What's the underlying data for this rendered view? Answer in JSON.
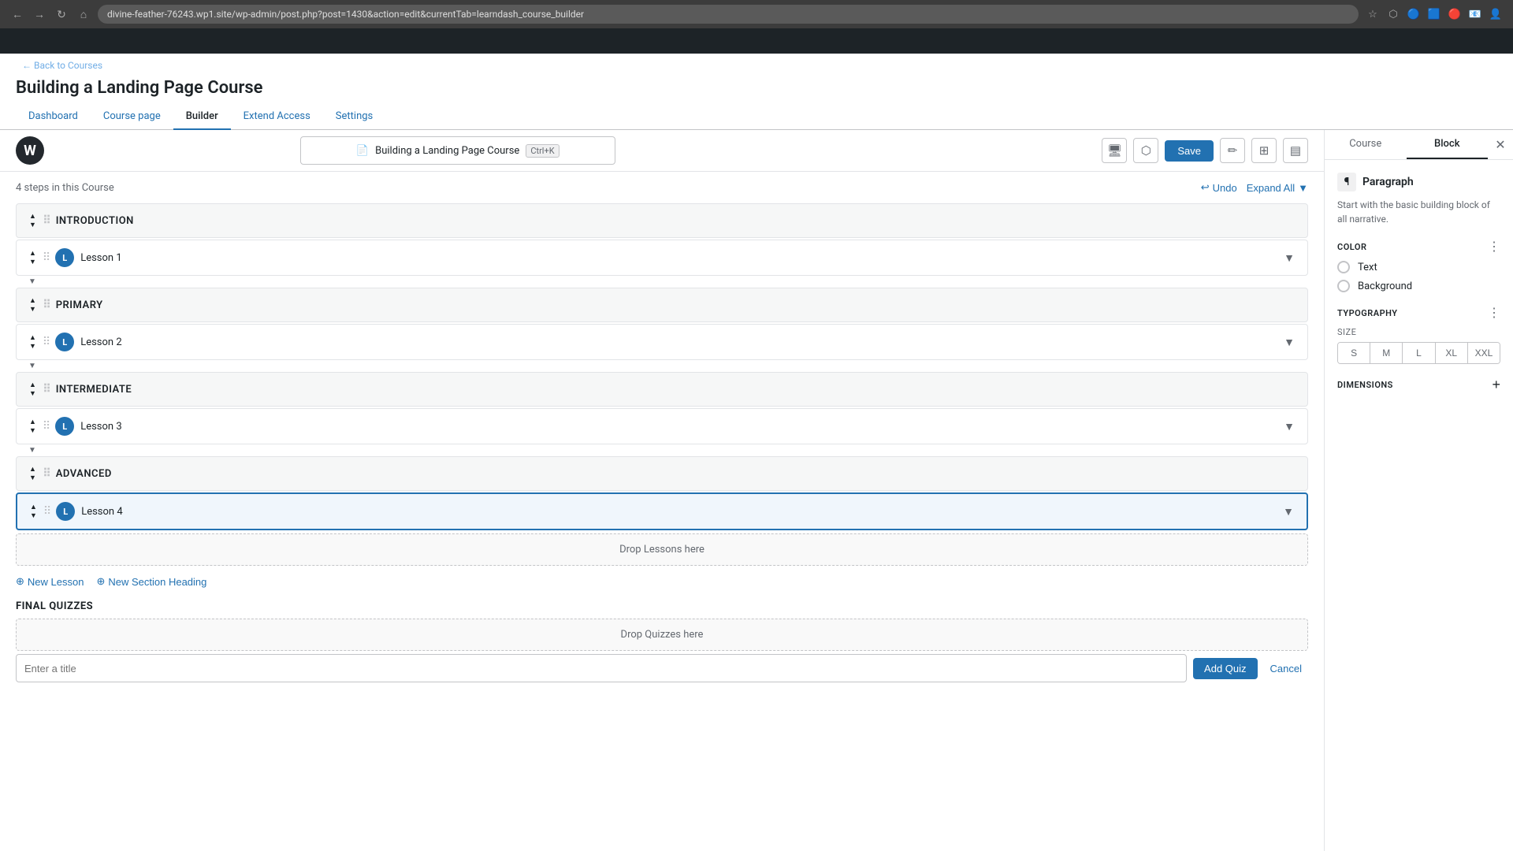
{
  "browser": {
    "url": "divine-feather-76243.wp1.site/wp-admin/post.php?post=1430&action=edit&currentTab=learndash_course_builder",
    "nav": {
      "back": "←",
      "forward": "→",
      "refresh": "↻"
    }
  },
  "admin": {
    "back_link": "← Back to Courses",
    "page_title": "Building a Landing Page Course",
    "tabs": [
      {
        "id": "dashboard",
        "label": "Dashboard",
        "active": false
      },
      {
        "id": "course-page",
        "label": "Course page",
        "active": false
      },
      {
        "id": "builder",
        "label": "Builder",
        "active": true
      },
      {
        "id": "extend-access",
        "label": "Extend Access",
        "active": false
      },
      {
        "id": "settings",
        "label": "Settings",
        "active": false
      }
    ]
  },
  "toolbar": {
    "wp_logo": "W",
    "course_title": "Building a Landing Page Course",
    "keyboard_shortcut": "Ctrl+K",
    "save_label": "Save",
    "icons": {
      "desktop": "🖥",
      "external": "⬡",
      "edit": "✏",
      "grid": "⊞",
      "layout": "▤"
    }
  },
  "builder": {
    "steps_count": "4 steps in this Course",
    "undo_label": "Undo",
    "expand_all_label": "Expand All",
    "sections": [
      {
        "id": "introduction",
        "label": "INTRODUCTION",
        "lessons": [
          {
            "id": "lesson-1",
            "label": "Lesson 1",
            "active": false
          }
        ]
      },
      {
        "id": "primary",
        "label": "PRIMARY",
        "lessons": [
          {
            "id": "lesson-2",
            "label": "Lesson 2",
            "active": false
          }
        ]
      },
      {
        "id": "intermediate",
        "label": "INTERMEDIATE",
        "lessons": [
          {
            "id": "lesson-3",
            "label": "Lesson 3",
            "active": false
          }
        ]
      },
      {
        "id": "advanced",
        "label": "ADVANCED",
        "lessons": [
          {
            "id": "lesson-4",
            "label": "Lesson 4",
            "active": true
          }
        ]
      }
    ],
    "drop_lessons_label": "Drop Lessons here",
    "drop_quizzes_label": "Drop Quizzes here",
    "add_lesson_label": "New Lesson",
    "add_section_label": "New Section Heading",
    "final_quizzes_label": "FINAL QUIZZES",
    "add_quiz_btn_label": "Add Quiz",
    "cancel_btn_label": "Cancel",
    "quiz_input_placeholder": "Enter a title"
  },
  "sidebar": {
    "course_tab": "Course",
    "block_tab": "Block",
    "close_icon": "✕",
    "block": {
      "icon": "¶",
      "name": "Paragraph",
      "description": "Start with the basic building block of all narrative."
    },
    "color": {
      "title": "Color",
      "options": [
        {
          "id": "text",
          "label": "Text"
        },
        {
          "id": "background",
          "label": "Background"
        }
      ]
    },
    "typography": {
      "title": "Typography",
      "size_label": "SIZE",
      "sizes": [
        "S",
        "M",
        "L",
        "XL",
        "XXL"
      ]
    },
    "dimensions": {
      "title": "Dimensions"
    }
  }
}
